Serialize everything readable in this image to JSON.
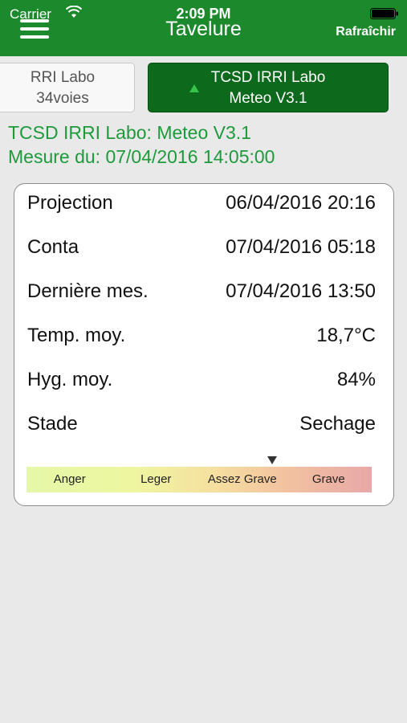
{
  "status_bar": {
    "carrier": "Carrier",
    "time": "2:09 PM"
  },
  "nav": {
    "title": "Tavelure",
    "refresh_label": "Rafraîchir"
  },
  "stations": [
    {
      "line1": "RRI Labo",
      "line2": "34voies"
    },
    {
      "line1": "TCSD IRRI Labo",
      "line2": "Meteo V3.1"
    }
  ],
  "info": {
    "station_name": "TCSD IRRI Labo: Meteo V3.1",
    "measure_date": "Mesure du: 07/04/2016 14:05:00"
  },
  "details": [
    {
      "label": "Projection",
      "value": "06/04/2016 20:16"
    },
    {
      "label": "Conta",
      "value": "07/04/2016 05:18"
    },
    {
      "label": "Dernière mes.",
      "value": "07/04/2016 13:50"
    },
    {
      "label": "Temp. moy.",
      "value": "18,7°C"
    },
    {
      "label": "Hyg. moy.",
      "value": "84%"
    },
    {
      "label": "Stade",
      "value": "Sechage"
    }
  ],
  "severity": {
    "levels": [
      "Anger",
      "Leger",
      "Assez Grave",
      "Grave"
    ],
    "current_level": "Assez Grave",
    "colors": [
      "#e5f7a8",
      "#eef7a0",
      "#f6dfa0",
      "#f2c2a0",
      "#e8a8a8"
    ]
  },
  "colors": {
    "header_green": "#1c8a2c",
    "selected_station": "#0d6a1c",
    "info_text_green": "#1e9a3a"
  }
}
